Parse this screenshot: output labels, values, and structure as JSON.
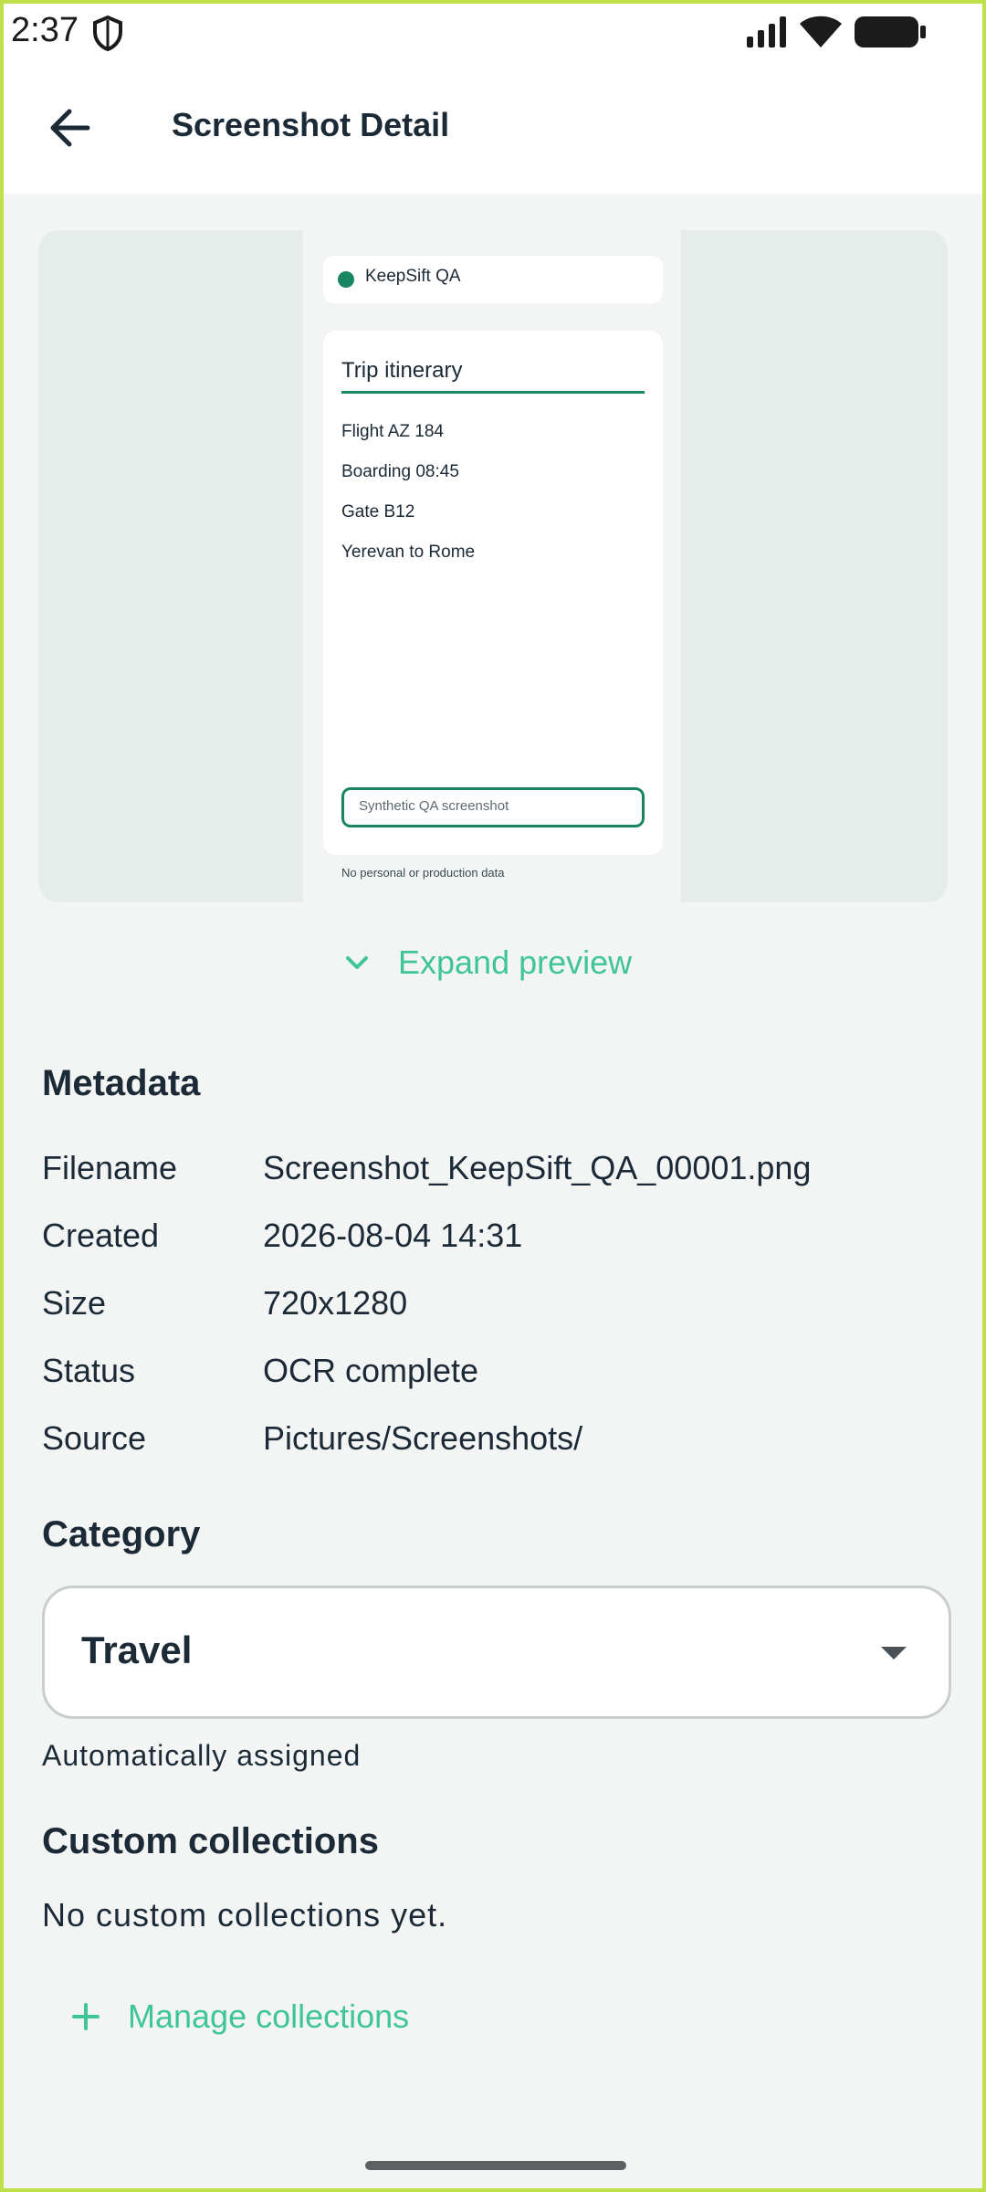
{
  "status": {
    "time": "2:37"
  },
  "appbar": {
    "title": "Screenshot Detail"
  },
  "preview": {
    "brand": "KeepSift QA",
    "card_title": "Trip itinerary",
    "lines": [
      "Flight AZ 184",
      "Boarding 08:45",
      "Gate B12",
      "Yerevan to Rome"
    ],
    "input_text": "Synthetic QA screenshot",
    "footer": "No personal or production data",
    "expand_label": "Expand preview",
    "accent_color": "#1a8563"
  },
  "metadata": {
    "heading": "Metadata",
    "rows": [
      {
        "key": "Filename",
        "value": "Screenshot_KeepSift_QA_00001.png"
      },
      {
        "key": "Created",
        "value": "2026-08-04 14:31"
      },
      {
        "key": "Size",
        "value": "720x1280"
      },
      {
        "key": "Status",
        "value": "OCR complete"
      },
      {
        "key": "Source",
        "value": "Pictures/Screenshots/"
      }
    ]
  },
  "category": {
    "heading": "Category",
    "selected": "Travel",
    "helper": "Automatically assigned"
  },
  "collections": {
    "heading": "Custom collections",
    "empty": "No custom collections yet.",
    "manage_label": "Manage collections",
    "link_color": "#3fc596"
  }
}
